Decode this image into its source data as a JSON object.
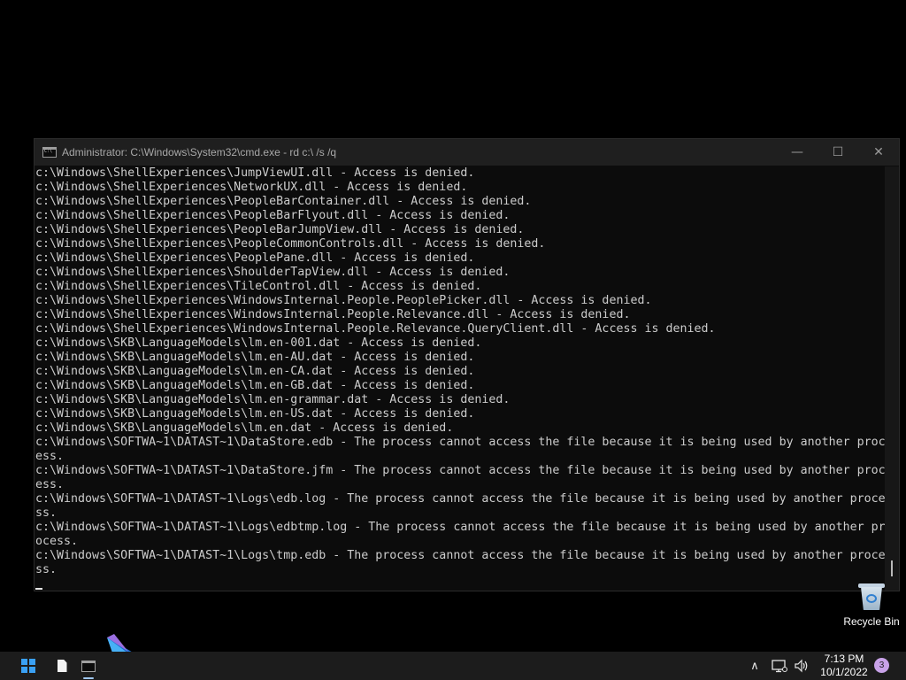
{
  "window": {
    "title": "Administrator: C:\\Windows\\System32\\cmd.exe - rd  c:\\ /s /q",
    "minimize_glyph": "—",
    "maximize_glyph": "☐",
    "close_glyph": "✕"
  },
  "console": {
    "lines": [
      "c:\\Windows\\ShellExperiences\\JumpViewUI.dll - Access is denied.",
      "c:\\Windows\\ShellExperiences\\NetworkUX.dll - Access is denied.",
      "c:\\Windows\\ShellExperiences\\PeopleBarContainer.dll - Access is denied.",
      "c:\\Windows\\ShellExperiences\\PeopleBarFlyout.dll - Access is denied.",
      "c:\\Windows\\ShellExperiences\\PeopleBarJumpView.dll - Access is denied.",
      "c:\\Windows\\ShellExperiences\\PeopleCommonControls.dll - Access is denied.",
      "c:\\Windows\\ShellExperiences\\PeoplePane.dll - Access is denied.",
      "c:\\Windows\\ShellExperiences\\ShoulderTapView.dll - Access is denied.",
      "c:\\Windows\\ShellExperiences\\TileControl.dll - Access is denied.",
      "c:\\Windows\\ShellExperiences\\WindowsInternal.People.PeoplePicker.dll - Access is denied.",
      "c:\\Windows\\ShellExperiences\\WindowsInternal.People.Relevance.dll - Access is denied.",
      "c:\\Windows\\ShellExperiences\\WindowsInternal.People.Relevance.QueryClient.dll - Access is denied.",
      "c:\\Windows\\SKB\\LanguageModels\\lm.en-001.dat - Access is denied.",
      "c:\\Windows\\SKB\\LanguageModels\\lm.en-AU.dat - Access is denied.",
      "c:\\Windows\\SKB\\LanguageModels\\lm.en-CA.dat - Access is denied.",
      "c:\\Windows\\SKB\\LanguageModels\\lm.en-GB.dat - Access is denied.",
      "c:\\Windows\\SKB\\LanguageModels\\lm.en-grammar.dat - Access is denied.",
      "c:\\Windows\\SKB\\LanguageModels\\lm.en-US.dat - Access is denied.",
      "c:\\Windows\\SKB\\LanguageModels\\lm.en.dat - Access is denied.",
      "c:\\Windows\\SOFTWA~1\\DATAST~1\\DataStore.edb - The process cannot access the file because it is being used by another proc",
      "ess.",
      "c:\\Windows\\SOFTWA~1\\DATAST~1\\DataStore.jfm - The process cannot access the file because it is being used by another proc",
      "ess.",
      "c:\\Windows\\SOFTWA~1\\DATAST~1\\Logs\\edb.log - The process cannot access the file because it is being used by another proce",
      "ss.",
      "c:\\Windows\\SOFTWA~1\\DATAST~1\\Logs\\edbtmp.log - The process cannot access the file because it is being used by another pr",
      "ocess.",
      "c:\\Windows\\SOFTWA~1\\DATAST~1\\Logs\\tmp.edb - The process cannot access the file because it is being used by another proce",
      "ss."
    ]
  },
  "desktop": {
    "recycle_bin_label": "Recycle Bin"
  },
  "taskbar": {
    "tray_chevron_glyph": "∧",
    "clock_time": "7:13 PM",
    "clock_date": "10/1/2022",
    "notification_count": "3"
  },
  "colors": {
    "console_bg": "#0c0c0c",
    "console_text": "#cccccc",
    "titlebar_bg": "#1f1f1f",
    "taskbar_bg": "#1c1c1c",
    "start_accent": "#3aa0f3"
  }
}
